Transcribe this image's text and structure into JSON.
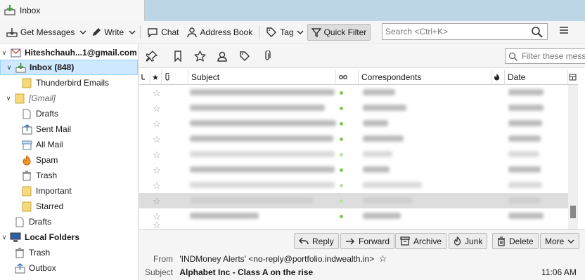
{
  "tab": {
    "title": "Inbox"
  },
  "toolbar": {
    "get_messages": "Get Messages",
    "write": "Write",
    "chat": "Chat",
    "address_book": "Address Book",
    "tag": "Tag",
    "quick_filter": "Quick Filter",
    "search_placeholder": "Search <Ctrl+K>"
  },
  "folders": {
    "account": "Hiteshchauh...1@gmail.com",
    "inbox": "Inbox (848)",
    "thunderbird_emails": "Thunderbird Emails",
    "gmail": "[Gmail]",
    "drafts": "Drafts",
    "sent_mail": "Sent Mail",
    "all_mail": "All Mail",
    "spam": "Spam",
    "trash": "Trash",
    "important": "Important",
    "starred": "Starred",
    "drafts2": "Drafts",
    "local_folders": "Local Folders",
    "local_trash": "Trash",
    "outbox": "Outbox"
  },
  "quickfilter": {
    "placeholder": "Filter these messages <Ctrl+Shift+K>"
  },
  "columns": {
    "subject": "Subject",
    "correspondents": "Correspondents",
    "date": "Date"
  },
  "colors": {
    "accent": "#cde8ff",
    "unread_dot": "#7ec850",
    "read_dot": "#b8e0a0",
    "selected_row": "#dddddd"
  },
  "actions": {
    "reply": "Reply",
    "forward": "Forward",
    "archive": "Archive",
    "junk": "Junk",
    "delete": "Delete",
    "more": "More"
  },
  "message": {
    "from_label": "From",
    "from_value": "'INDMoney Alerts' <no-reply@portfolio.indwealth.in>",
    "subject_label": "Subject",
    "subject_value": "Alphabet Inc - Class A on the rise",
    "time": "11:06 AM"
  }
}
